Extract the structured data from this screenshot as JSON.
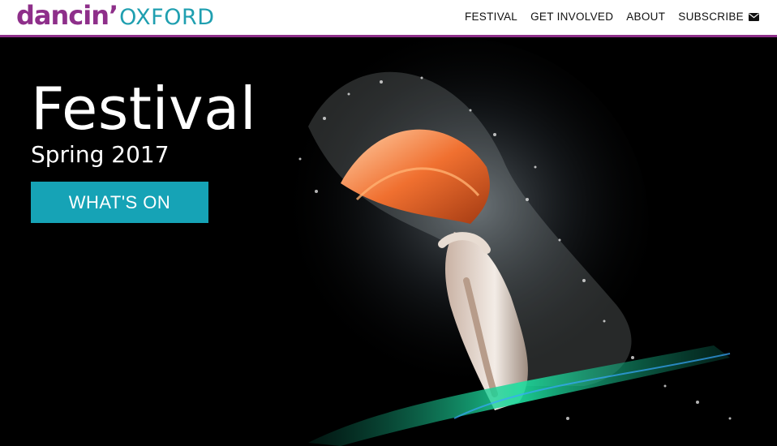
{
  "header": {
    "logo": {
      "part1": "dancin’",
      "part2": "OXFORD"
    },
    "nav": {
      "items": [
        {
          "label": "FESTIVAL"
        },
        {
          "label": "GET INVOLVED"
        },
        {
          "label": "ABOUT"
        },
        {
          "label": "SUBSCRIBE",
          "icon": "envelope-icon"
        }
      ]
    }
  },
  "hero": {
    "title": "Festival",
    "subtitle": "Spring 2017",
    "cta_label": "WHAT'S ON"
  },
  "colors": {
    "brand_purple": "#8e2f8a",
    "brand_teal": "#1f9fb0",
    "cta_background": "#16a3b6",
    "hero_background": "#000000"
  }
}
